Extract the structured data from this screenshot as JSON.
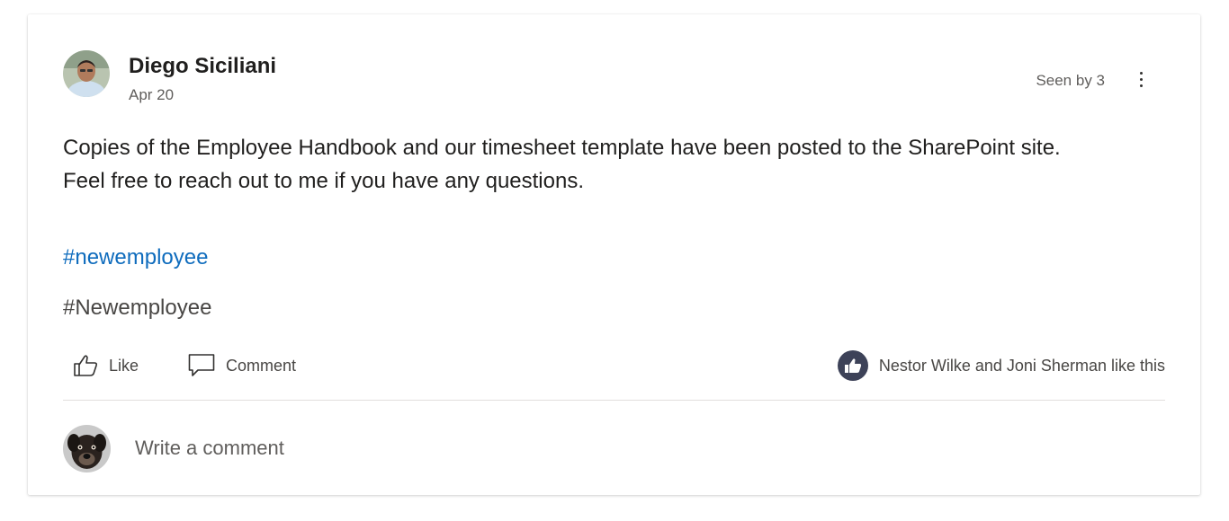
{
  "post": {
    "author": "Diego Siciliani",
    "date": "Apr 20",
    "seen_by": "Seen by 3",
    "body_line1": "Copies of the Employee Handbook and our timesheet template have been posted to the SharePoint site.",
    "body_line2": "Feel free to reach out to me if you have any questions.",
    "hashtag_link": "#newemployee",
    "hashtag_plain": "#Newemployee"
  },
  "actions": {
    "like_label": "Like",
    "comment_label": "Comment"
  },
  "reactions": {
    "summary": "Nestor Wilke and Joni Sherman like this"
  },
  "comment_box": {
    "placeholder": "Write a comment"
  },
  "colors": {
    "link": "#0f6cbd",
    "like_badge": "#3d4258",
    "divider": "#e1dfdd"
  },
  "icons": [
    "more-options-icon",
    "like-icon",
    "comment-icon",
    "thumbs-up-badge-icon"
  ]
}
